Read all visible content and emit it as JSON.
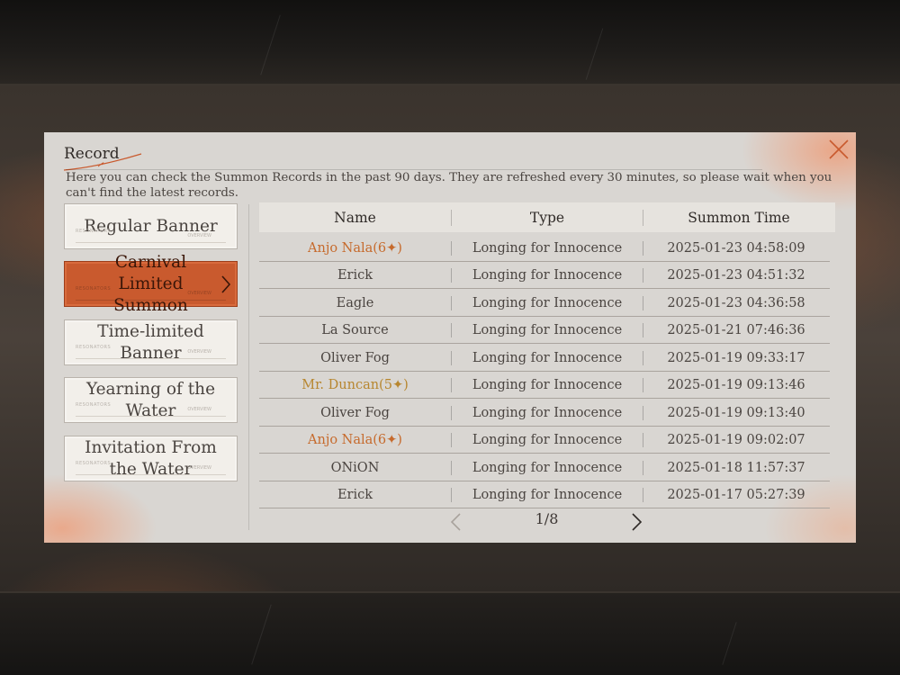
{
  "dialog": {
    "title": "Record",
    "hint": "Here you can check the Summon Records in the past 90 days. They are refreshed every 30 minutes, so please wait when you can't find the latest records.",
    "close_icon": "close-icon"
  },
  "banners": [
    {
      "label": "Regular Banner",
      "active": false
    },
    {
      "label": "Carnival Limited Summon",
      "active": true
    },
    {
      "label": "Time-limited Banner",
      "active": false
    },
    {
      "label": "Yearning of the Water",
      "active": false
    },
    {
      "label": "Invitation From the Water",
      "active": false
    }
  ],
  "banner_decor": {
    "left": "RESONATORS",
    "right": "OVERVIEW"
  },
  "table": {
    "headers": {
      "name": "Name",
      "type": "Type",
      "time": "Summon Time"
    },
    "rows": [
      {
        "name": "Anjo Nala(6✦)",
        "type": "Longing for Innocence",
        "time": "2025-01-23 04:58:09",
        "rarity": "six"
      },
      {
        "name": "Erick",
        "type": "Longing for Innocence",
        "time": "2025-01-23 04:51:32",
        "rarity": "normal"
      },
      {
        "name": "Eagle",
        "type": "Longing for Innocence",
        "time": "2025-01-23 04:36:58",
        "rarity": "normal"
      },
      {
        "name": "La Source",
        "type": "Longing for Innocence",
        "time": "2025-01-21 07:46:36",
        "rarity": "normal"
      },
      {
        "name": "Oliver Fog",
        "type": "Longing for Innocence",
        "time": "2025-01-19 09:33:17",
        "rarity": "normal"
      },
      {
        "name": "Mr. Duncan(5✦)",
        "type": "Longing for Innocence",
        "time": "2025-01-19 09:13:46",
        "rarity": "five"
      },
      {
        "name": "Oliver Fog",
        "type": "Longing for Innocence",
        "time": "2025-01-19 09:13:40",
        "rarity": "normal"
      },
      {
        "name": "Anjo Nala(6✦)",
        "type": "Longing for Innocence",
        "time": "2025-01-19 09:02:07",
        "rarity": "six"
      },
      {
        "name": "ONiON",
        "type": "Longing for Innocence",
        "time": "2025-01-18 11:57:37",
        "rarity": "normal"
      },
      {
        "name": "Erick",
        "type": "Longing for Innocence",
        "time": "2025-01-17 05:27:39",
        "rarity": "normal"
      }
    ]
  },
  "pagination": {
    "text": "1/8",
    "prev_icon": "chevron-left-icon",
    "next_icon": "chevron-right-icon"
  },
  "colors": {
    "accent": "#c95a2e",
    "six_star": "#c66a2c",
    "five_star": "#b7862f",
    "panel": "#d9d6d2"
  }
}
